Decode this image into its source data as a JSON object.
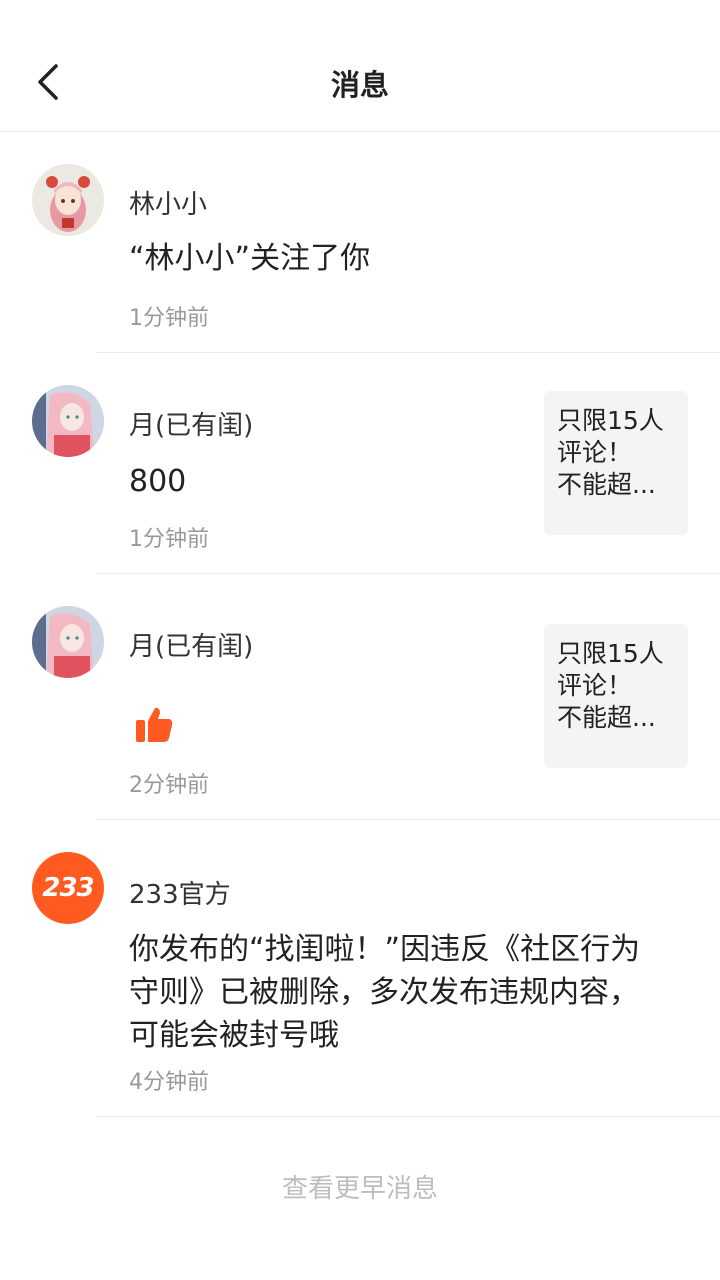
{
  "header": {
    "title": "消息"
  },
  "messages": [
    {
      "name": "林小小",
      "content": "“林小小”关注了你",
      "time": "1分钟前"
    },
    {
      "name": "月(已有闺)",
      "content": "800",
      "time": "1分钟前",
      "quote": "只限15人\n评论！\n不能超..."
    },
    {
      "name": "月(已有闺)",
      "content": "",
      "time": "2分钟前",
      "quote": "只限15人\n评论！\n不能超...",
      "icon": "thumbs-up-icon"
    },
    {
      "name": "233官方",
      "avatar_text": "233",
      "content": "你发布的“找闺啦！”因违反《社区行为守则》已被删除，多次发布违规内容，可能会被封号哦",
      "time": "4分钟前"
    }
  ],
  "footer": {
    "more_label": "查看更早消息"
  },
  "colors": {
    "accent": "#ff5a1f",
    "divider": "#ececec",
    "muted": "#999999"
  }
}
